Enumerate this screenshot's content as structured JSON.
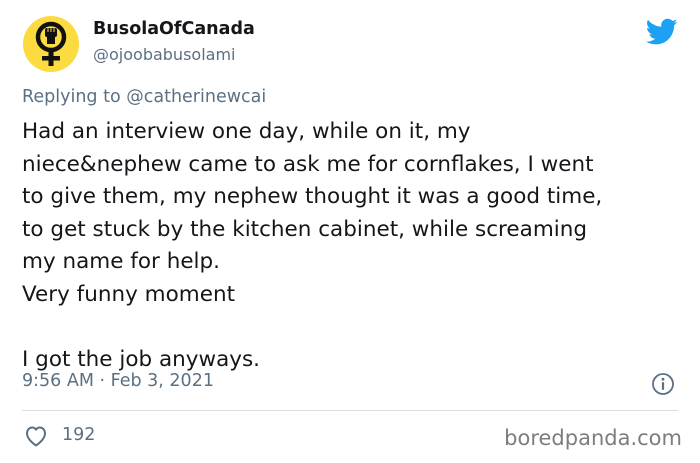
{
  "tweet": {
    "display_name": "BusolaOfCanada",
    "handle": "@ojoobabusolami",
    "reply_to_prefix": "Replying to ",
    "reply_to_handle": "@catherinewcai",
    "body_lines": [
      "Had an interview one day, while on it, my",
      "niece&nephew came to ask me for cornflakes, I went",
      "to give them, my nephew thought it was a good time,",
      "to get stuck by the kitchen cabinet, while screaming",
      "my name for help.",
      "Very funny moment",
      "",
      "I got the job anyways."
    ],
    "timestamp": "9:56 AM · Feb 3, 2021",
    "like_count": "192"
  },
  "watermark": "boredpanda.com",
  "colors": {
    "avatar_bg": "#fbdb3f",
    "twitter_blue": "#1da1f2",
    "secondary_text": "#5b7083",
    "primary_text": "#141619"
  },
  "icons": {
    "avatar": "raised-fist-female-symbol-icon",
    "brand": "twitter-bird-icon",
    "info": "info-icon",
    "like": "heart-icon"
  }
}
